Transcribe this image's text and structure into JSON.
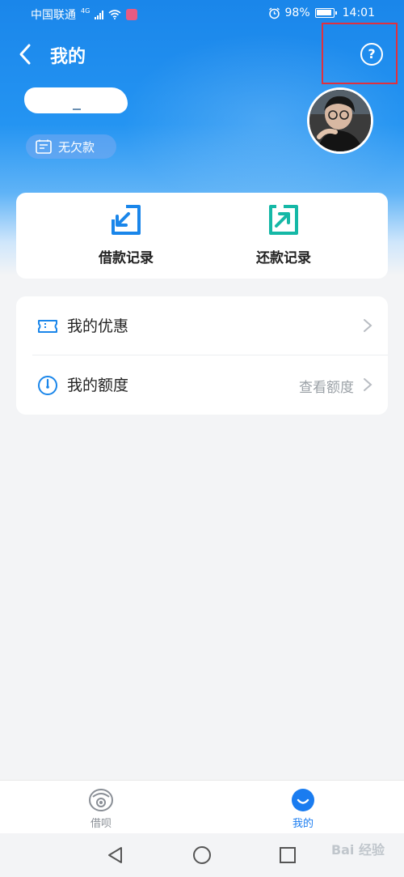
{
  "status_bar": {
    "carrier": "中国联通",
    "network": "4G",
    "battery": "98%",
    "time": "14:01"
  },
  "header": {
    "title": "我的"
  },
  "profile": {
    "debt_status": "无欠款"
  },
  "records": {
    "borrow_label": "借款记录",
    "repay_label": "还款记录"
  },
  "menu": {
    "coupons_label": "我的优惠",
    "quota_label": "我的额度",
    "quota_hint": "查看额度"
  },
  "tabbar": {
    "borrow_label": "借呗",
    "mine_label": "我的"
  },
  "colors": {
    "primary_blue": "#1a86ea",
    "accent_teal": "#15b8a6",
    "highlight_red": "#e0303e",
    "tab_active": "#1a7cf0"
  },
  "watermark": "Bai 经验"
}
